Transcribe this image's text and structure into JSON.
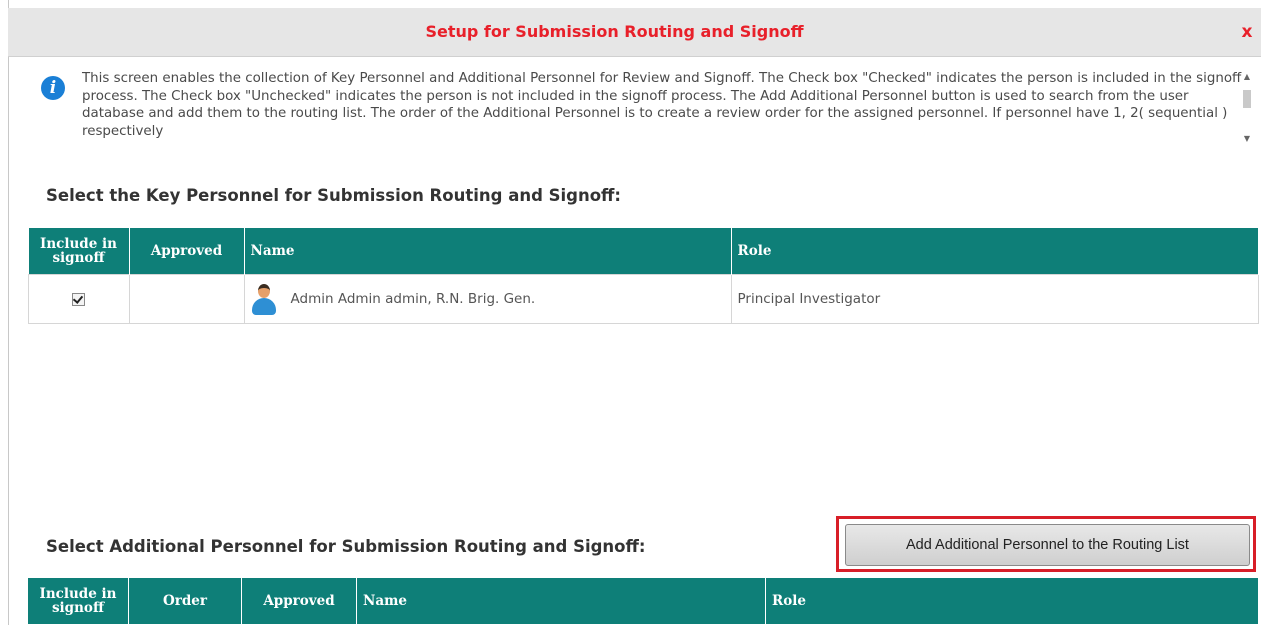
{
  "dialog": {
    "title": "Setup for Submission Routing and Signoff",
    "close_label": "x"
  },
  "info": {
    "text": "This screen enables the collection of Key Personnel and Additional Personnel for Review and Signoff. The Check box \"Checked\" indicates the person is included in the signoff process. The Check box \"Unchecked\" indicates the person is not included in the signoff process. The Add Additional Personnel button is used to search from the user database and add them to the routing list. The order of the Additional Personnel is to create a review order for the assigned personnel. If personnel have 1, 2( sequential ) respectively"
  },
  "key_personnel": {
    "heading": "Select the Key Personnel for Submission Routing and Signoff:",
    "columns": {
      "include": "Include in signoff",
      "approved": "Approved",
      "name": "Name",
      "role": "Role"
    },
    "rows": [
      {
        "include": true,
        "approved": "",
        "name": "Admin Admin admin, R.N. Brig. Gen.",
        "role": "Principal Investigator"
      }
    ]
  },
  "additional_personnel": {
    "heading": "Select Additional Personnel for Submission Routing and Signoff:",
    "add_button_label": "Add Additional Personnel to the Routing List",
    "columns": {
      "include": "Include in signoff",
      "order": "Order",
      "approved": "Approved",
      "name": "Name",
      "role": "Role"
    }
  },
  "colors": {
    "title_red": "#e8202a",
    "header_teal": "#0e7f78",
    "highlight_red": "#d81e28"
  }
}
